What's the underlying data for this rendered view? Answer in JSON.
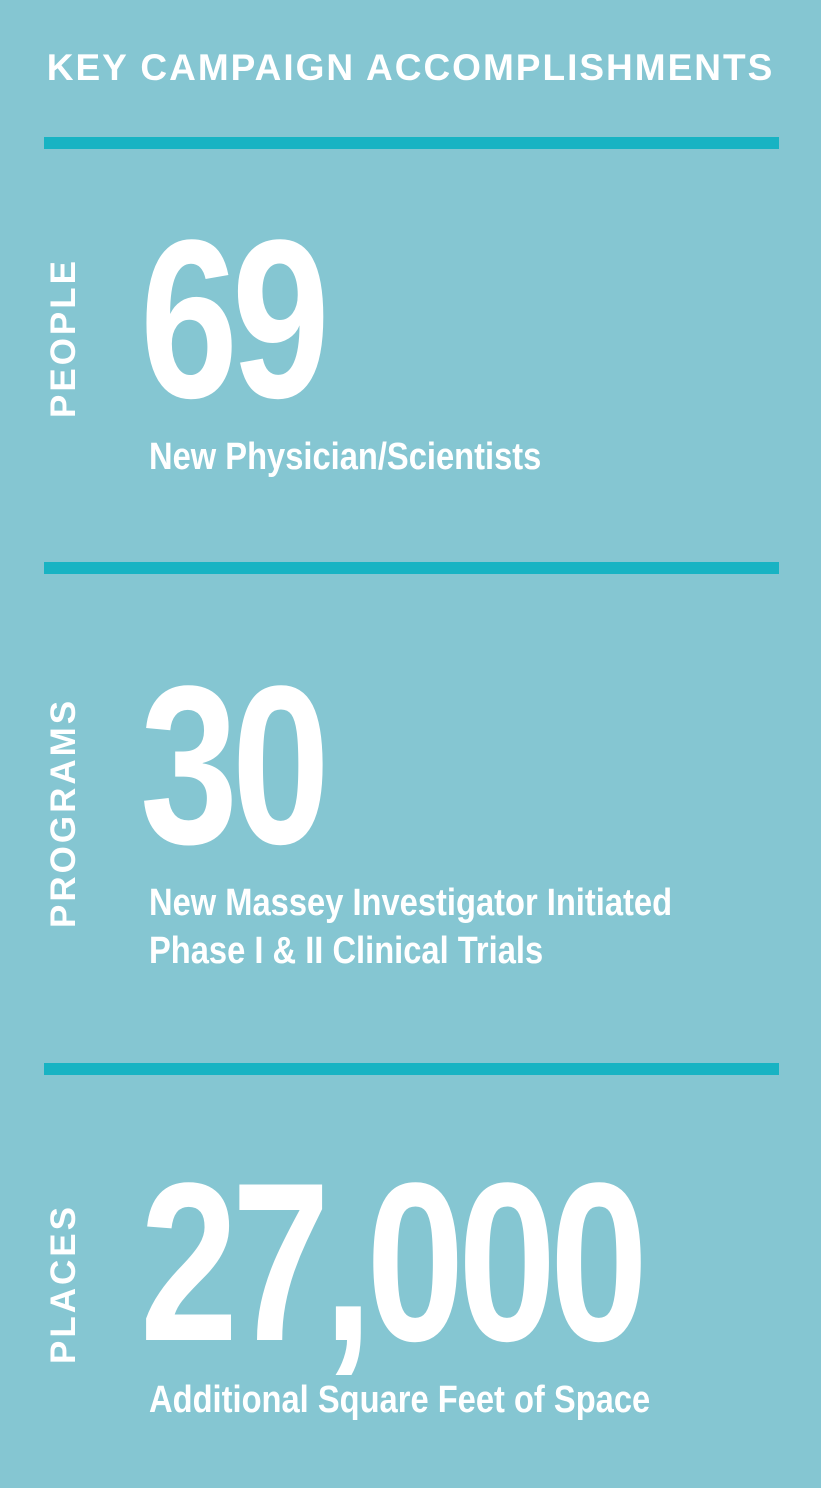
{
  "title": "KEY CAMPAIGN ACCOMPLISHMENTS",
  "colors": {
    "background": "#85c6d2",
    "divider": "#18b3c3",
    "text": "#ffffff"
  },
  "sections": [
    {
      "label": "PEOPLE",
      "value": "69",
      "description_lines": [
        "New Physician/Scientists"
      ]
    },
    {
      "label": "PROGRAMS",
      "value": "30",
      "description_lines": [
        "New Massey Investigator Initiated",
        "Phase I & II Clinical Trials"
      ]
    },
    {
      "label": "PLACES",
      "value": "27,000",
      "description_lines": [
        "Additional Square Feet of Space"
      ]
    }
  ]
}
